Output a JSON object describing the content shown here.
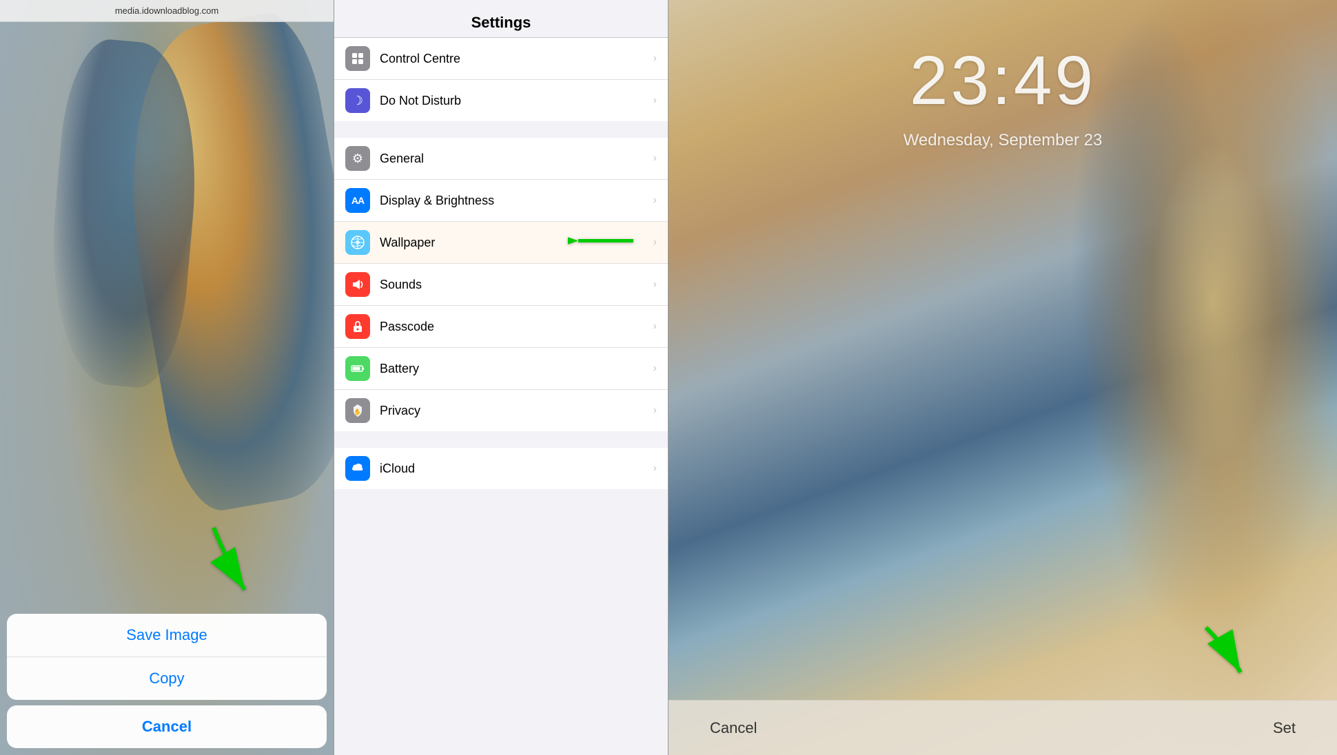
{
  "panel1": {
    "url": "media.idownloadblog.com",
    "action_sheet": {
      "save_image": "Save Image",
      "copy": "Copy",
      "cancel": "Cancel"
    }
  },
  "panel2": {
    "header_title": "Settings",
    "sections": [
      {
        "items": [
          {
            "id": "control-centre",
            "label": "Control Centre",
            "icon_color": "grey",
            "icon_char": "⊞"
          },
          {
            "id": "do-not-disturb",
            "label": "Do Not Disturb",
            "icon_color": "purple",
            "icon_char": "🌙"
          }
        ]
      },
      {
        "items": [
          {
            "id": "general",
            "label": "General",
            "icon_color": "grey",
            "icon_char": "⚙"
          },
          {
            "id": "display-brightness",
            "label": "Display & Brightness",
            "icon_color": "blue",
            "icon_char": "AA"
          },
          {
            "id": "wallpaper",
            "label": "Wallpaper",
            "icon_color": "teal",
            "icon_char": "❋",
            "highlighted": true
          },
          {
            "id": "sounds",
            "label": "Sounds",
            "icon_color": "pink-red",
            "icon_char": "🔊"
          },
          {
            "id": "passcode",
            "label": "Passcode",
            "icon_color": "red",
            "icon_char": "🔒"
          },
          {
            "id": "battery",
            "label": "Battery",
            "icon_color": "green",
            "icon_char": "🔋"
          },
          {
            "id": "privacy",
            "label": "Privacy",
            "icon_color": "grey-hand",
            "icon_char": "✋"
          }
        ]
      },
      {
        "items": [
          {
            "id": "icloud",
            "label": "iCloud",
            "icon_color": "blue-cloud",
            "icon_char": "☁"
          }
        ]
      }
    ]
  },
  "panel3": {
    "time": "23:49",
    "date": "Wednesday, September 23",
    "cancel_button": "Cancel",
    "set_button": "Set"
  },
  "icons": {
    "chevron": "›",
    "moon": "☽",
    "gear": "⚙",
    "lock": "🔒",
    "speaker": "📢",
    "battery": "🔋",
    "hand": "✋",
    "cloud": "☁"
  }
}
